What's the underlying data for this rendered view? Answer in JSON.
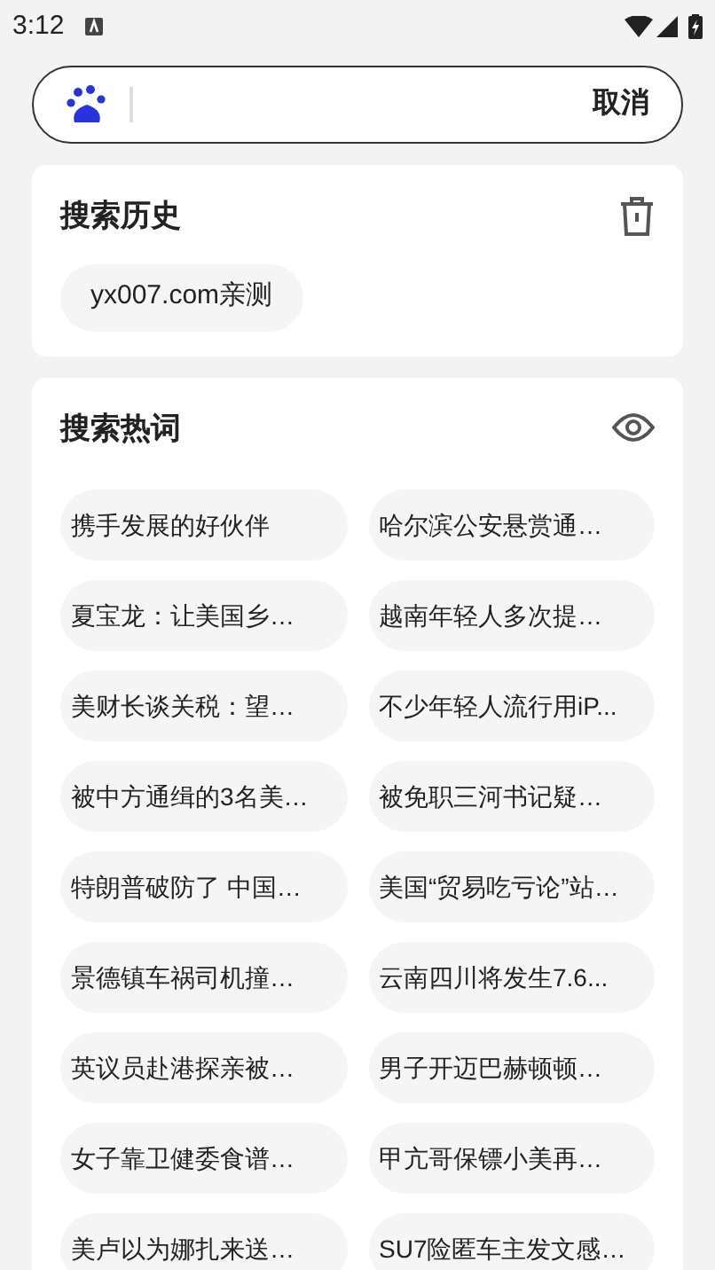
{
  "status_bar": {
    "time": "3:12"
  },
  "search": {
    "cancel": "取消"
  },
  "history": {
    "title": "搜索历史",
    "items": [
      "yx007.com亲测"
    ]
  },
  "hot": {
    "title": "搜索热词",
    "items": [
      "携手发展的好伙伴",
      "哈尔滨公安悬赏通…",
      "夏宝龙：让美国乡…",
      "越南年轻人多次提…",
      "美财长谈关税：望…",
      "不少年轻人流行用iP...",
      "被中方通缉的3名美…",
      "被免职三河书记疑…",
      "特朗普破防了 中国…",
      "美国“贸易吃亏论”站…",
      "景德镇车祸司机撞…",
      "云南四川将发生7.6...",
      "英议员赴港探亲被…",
      "男子开迈巴赫顿顿…",
      "女子靠卫健委食谱…",
      "甲亢哥保镖小美再…",
      "美卢以为娜扎来送…",
      "SU7险匿车主发文感…"
    ]
  }
}
